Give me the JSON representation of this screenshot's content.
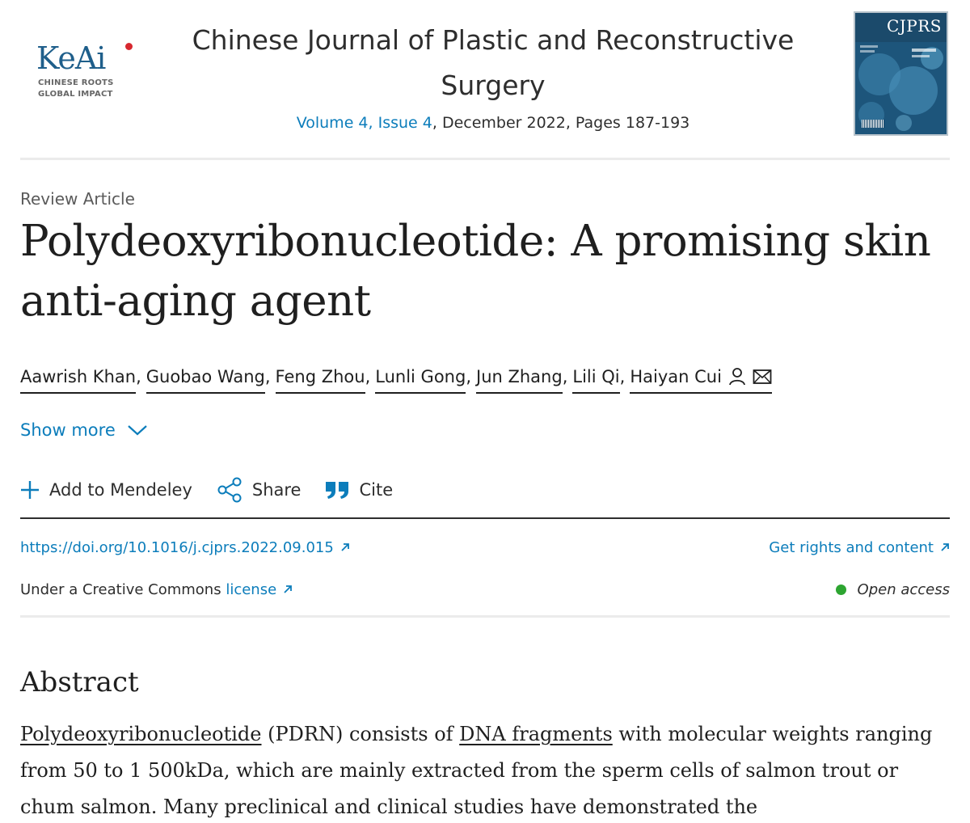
{
  "header": {
    "logo": {
      "word": "KeAi",
      "tagline_1": "CHINESE ROOTS",
      "tagline_2": "GLOBAL IMPACT"
    },
    "journal_title": "Chinese Journal of Plastic and Reconstructive Surgery",
    "volume_issue": "Volume 4, Issue 4",
    "date_pages": ", December 2022, Pages 187-193",
    "cover_abbrev": "CJPRS"
  },
  "article": {
    "type": "Review Article",
    "title": "Polydeoxyribonucleotide: A promising skin anti-aging agent",
    "authors": [
      "Aawrish Khan",
      "Guobao Wang",
      "Feng Zhou",
      "Lunli Gong",
      "Jun Zhang",
      "Lili Qi",
      "Haiyan Cui"
    ],
    "show_more": "Show more"
  },
  "toolbar": {
    "mendeley": "Add to Mendeley",
    "share": "Share",
    "cite": "Cite"
  },
  "meta": {
    "doi": "https://doi.org/10.1016/j.cjprs.2022.09.015",
    "rights": "Get rights and content",
    "license_prefix": "Under a Creative Commons ",
    "license_link": "license",
    "open_access": "Open access"
  },
  "abstract": {
    "heading": "Abstract",
    "term1": "Polydeoxyribonucleotide",
    "text1": " (PDRN) consists of ",
    "term2": "DNA fragments",
    "text2": " with molecular weights ranging from 50 to 1 500kDa, which are mainly extracted from the sperm cells of salmon trout or chum salmon. Many preclinical and clinical studies have demonstrated the"
  },
  "colors": {
    "link": "#0c7dbb",
    "open_access": "#2da531",
    "logo": "#1f5f8b"
  },
  "icons": [
    "user-icon",
    "envelope-icon",
    "chevron-down-icon",
    "plus-icon",
    "share-icon",
    "quote-icon",
    "external-arrow-icon"
  ]
}
